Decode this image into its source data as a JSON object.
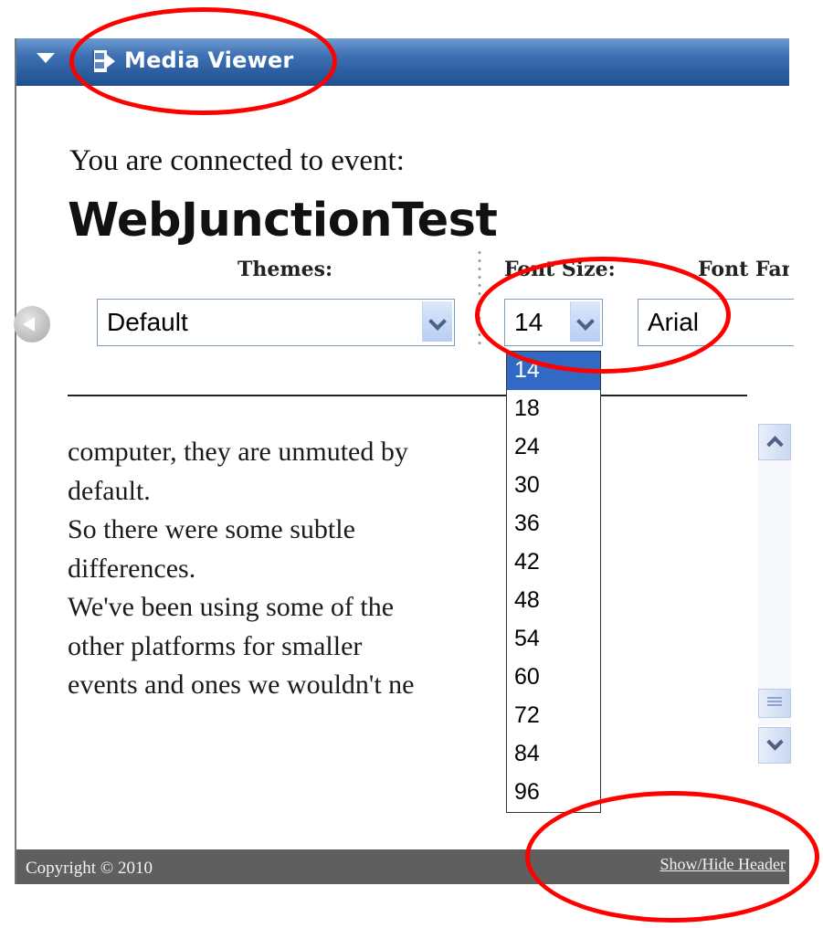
{
  "window": {
    "title": "Media Viewer",
    "icon": "film-icon"
  },
  "event": {
    "connected_label": "You are connected to event:",
    "name": "WebJunctionTest"
  },
  "settings": {
    "themes_label": "Themes:",
    "themes_value": "Default",
    "font_size_label": "Font Size:",
    "font_size_value": "14",
    "font_family_label": "Font Family:",
    "font_family_value": "Arial"
  },
  "font_size_options": [
    "14",
    "18",
    "24",
    "30",
    "36",
    "42",
    "48",
    "54",
    "60",
    "72",
    "84",
    "96"
  ],
  "font_size_selected": "14",
  "transcript_lines": [
    "computer, they are unmuted by",
    "default.",
    "So there were some subtle",
    "differences.",
    "We've been using some of the",
    "other platforms for smaller",
    "events and ones we wouldn't ne"
  ],
  "footer": {
    "copyright": "Copyright © 2010",
    "toggle_header": "Show/Hide Header"
  },
  "colors": {
    "titlebar": "#2f5f9f",
    "footer": "#5f5f5f",
    "selection": "#316ac5",
    "annotation": "#ff0000"
  }
}
